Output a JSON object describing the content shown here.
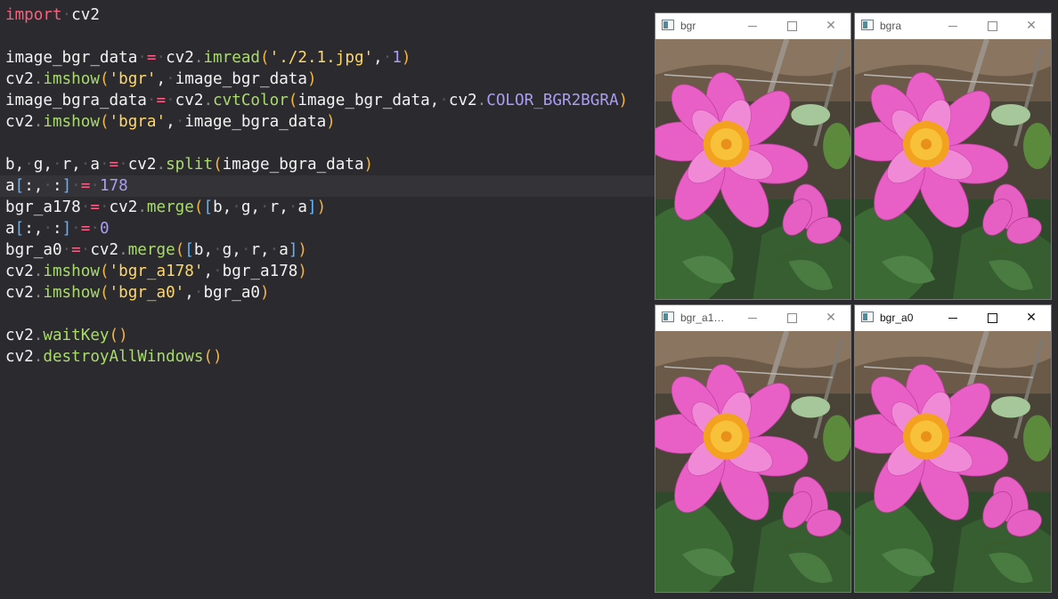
{
  "editor": {
    "lines": [
      "import cv2",
      "",
      "image_bgr_data = cv2.imread('./2.1.jpg', 1)",
      "cv2.imshow('bgr', image_bgr_data)",
      "image_bgra_data = cv2.cvtColor(image_bgr_data, cv2.COLOR_BGR2BGRA)",
      "cv2.imshow('bgra', image_bgra_data)",
      "",
      "b, g, r, a = cv2.split(image_bgra_data)",
      "a[:, :] = 178",
      "bgr_a178 = cv2.merge([b, g, r, a])",
      "a[:, :] = 0",
      "bgr_a0 = cv2.merge([b, g, r, a])",
      "cv2.imshow('bgr_a178', bgr_a178)",
      "cv2.imshow('bgr_a0', bgr_a0)",
      "",
      "cv2.waitKey()",
      "cv2.destroyAllWindows()"
    ],
    "current_line_index": 8
  },
  "windows": [
    {
      "title": "bgr",
      "active": false,
      "minimize_icon": "minimize-icon",
      "maximize_icon": "maximize-icon",
      "close_icon": "close-icon"
    },
    {
      "title": "bgra",
      "active": false,
      "minimize_icon": "minimize-icon",
      "maximize_icon": "maximize-icon",
      "close_icon": "close-icon"
    },
    {
      "title": "bgr_a1…",
      "active": false,
      "minimize_icon": "minimize-icon",
      "maximize_icon": "maximize-icon",
      "close_icon": "close-icon"
    },
    {
      "title": "bgr_a0",
      "active": true,
      "minimize_icon": "minimize-icon",
      "maximize_icon": "maximize-icon",
      "close_icon": "close-icon"
    }
  ],
  "colors": {
    "editor_bg": "#2b2a2e",
    "keyword": "#ff5f7e",
    "function": "#a9dc6b",
    "string": "#ffd866",
    "number": "#ab9df2",
    "flower_pink": "#e85fc6",
    "flower_center": "#f2a21e"
  }
}
